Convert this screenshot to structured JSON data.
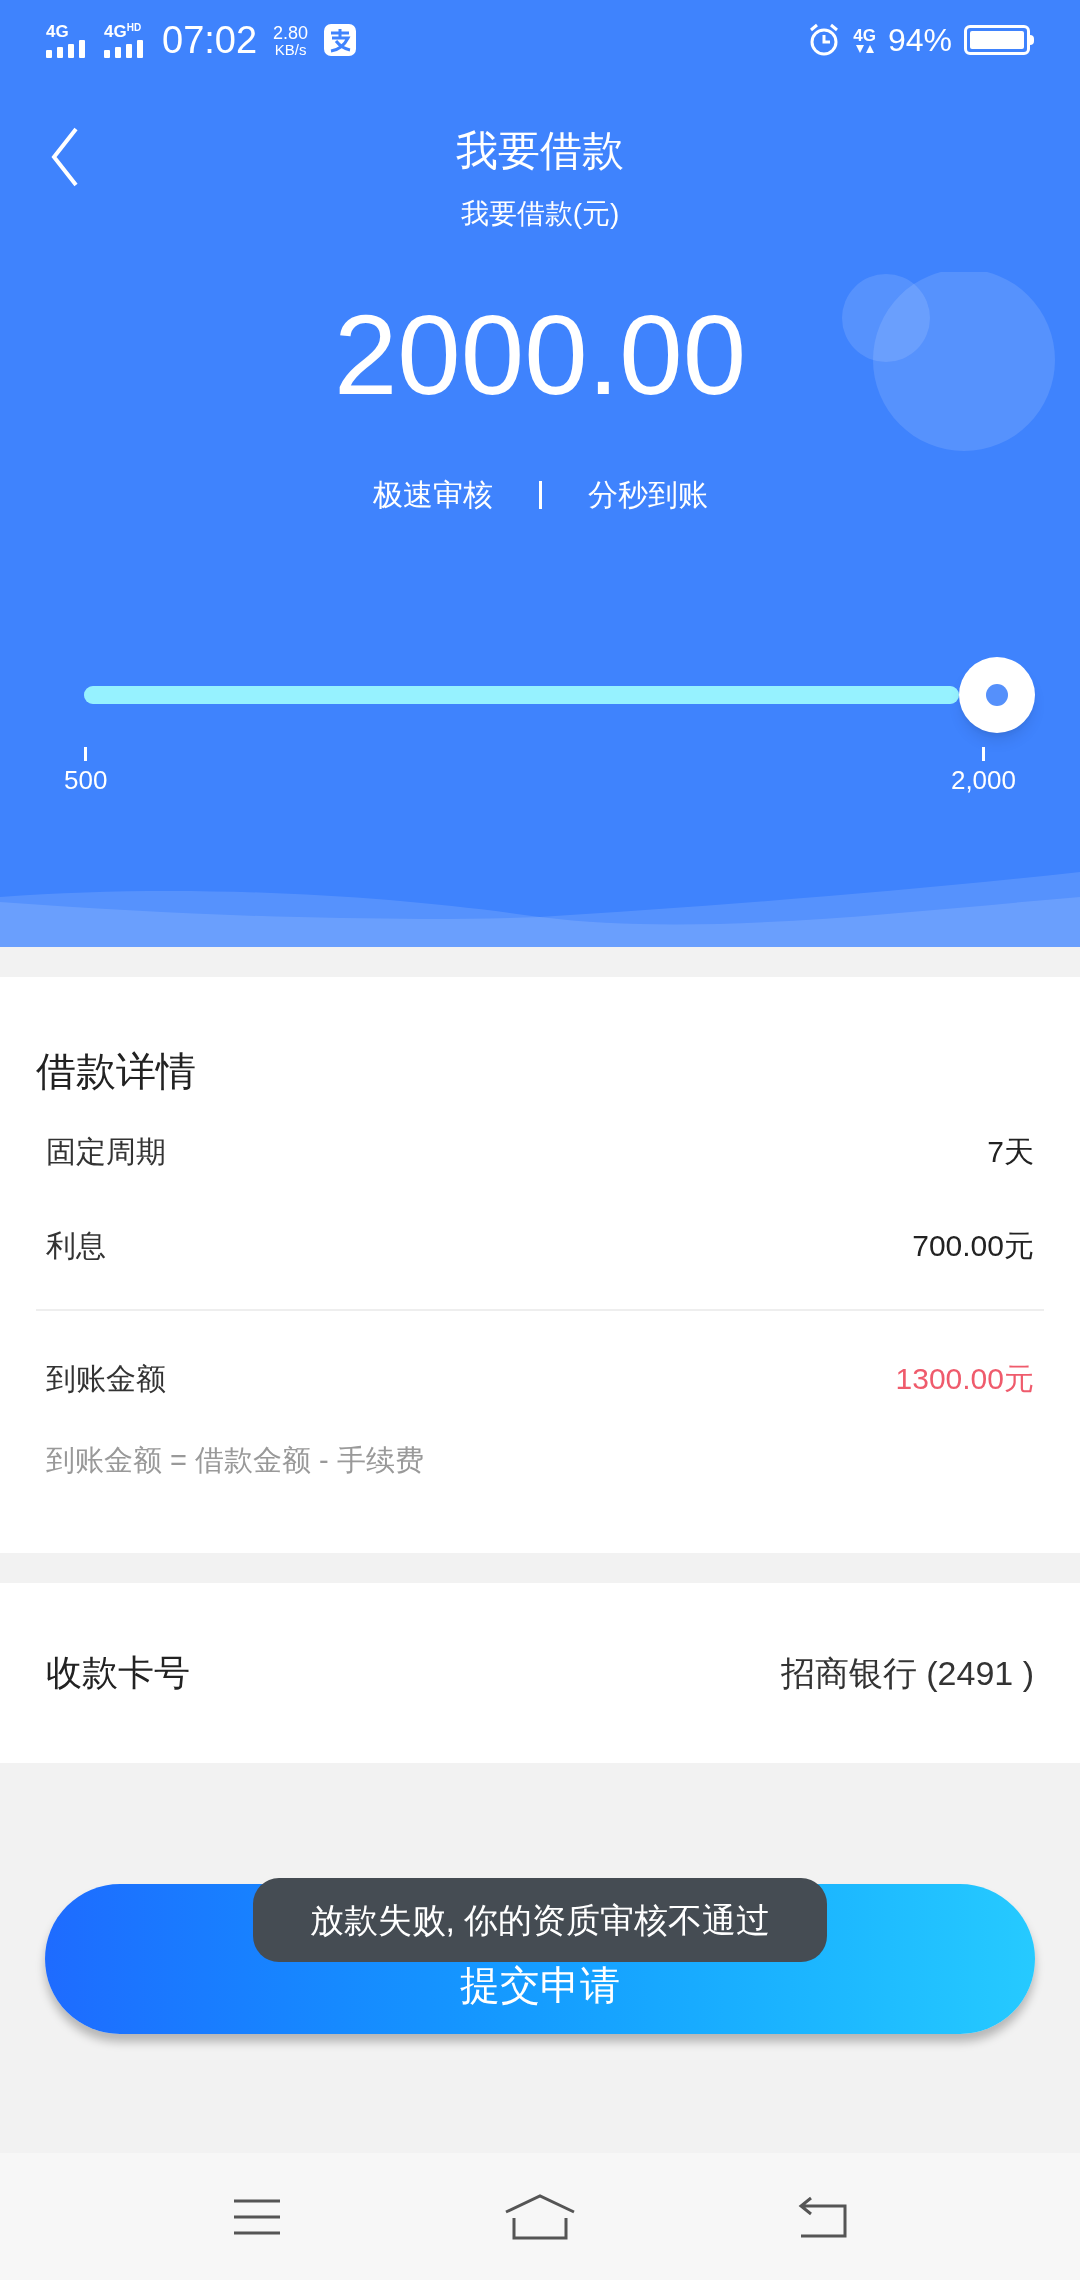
{
  "status_bar": {
    "network_1": "4G",
    "network_2": "4G",
    "network_2_badge": "HD",
    "time": "07:02",
    "speed": "2.80",
    "speed_unit": "KB/s",
    "network_3": "4G",
    "battery": "94%"
  },
  "header": {
    "title": "我要借款",
    "subtitle": "我要借款(元)",
    "amount": "2000.00",
    "features": [
      "极速审核",
      "分秒到账"
    ]
  },
  "slider": {
    "level": 1,
    "min_label": "500",
    "max_label": "2,000"
  },
  "details": {
    "title": "借款详情",
    "rows": [
      {
        "label": "固定周期",
        "value": "7天",
        "highlight": false
      },
      {
        "label": "利息",
        "value": "700.00元",
        "highlight": false
      }
    ],
    "total": {
      "label": "到账金额",
      "value": "1300.00元",
      "highlight": true
    },
    "formula": "到账金额 = 借款金额 - 手续费"
  },
  "card": {
    "label": "收款卡号",
    "value": "招商银行 (2491 )"
  },
  "submit_button": "提交申请",
  "toast": "放款失败, 你的资质审核不通过"
}
